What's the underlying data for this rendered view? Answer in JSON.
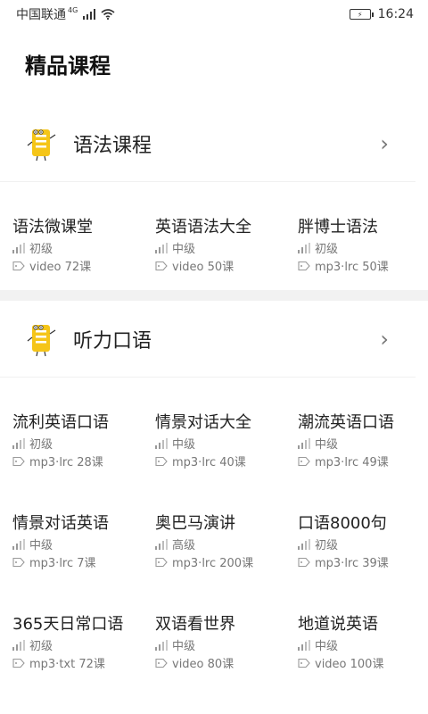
{
  "status_bar": {
    "carrier": "中国联通",
    "network": "4G",
    "time": "16:24"
  },
  "page_title": "精品课程",
  "sections": [
    {
      "title": "语法课程",
      "courses": [
        {
          "name": "语法微课堂",
          "level": "初级",
          "info": "video 72课"
        },
        {
          "name": "英语语法大全",
          "level": "中级",
          "info": "video 50课"
        },
        {
          "name": "胖博士语法",
          "level": "初级",
          "info": "mp3·lrc 50课"
        }
      ]
    },
    {
      "title": "听力口语",
      "courses": [
        {
          "name": "流利英语口语",
          "level": "初级",
          "info": "mp3·lrc 28课"
        },
        {
          "name": "情景对话大全",
          "level": "中级",
          "info": "mp3·lrc 40课"
        },
        {
          "name": "潮流英语口语",
          "level": "中级",
          "info": "mp3·lrc 49课"
        },
        {
          "name": "情景对话英语",
          "level": "中级",
          "info": "mp3·lrc 7课"
        },
        {
          "name": "奥巴马演讲",
          "level": "高级",
          "info": "mp3·lrc 200课"
        },
        {
          "name": "口语8000句",
          "level": "初级",
          "info": "mp3·lrc 39课"
        },
        {
          "name": "365天日常口语",
          "level": "初级",
          "info": "mp3·txt 72课"
        },
        {
          "name": "双语看世界",
          "level": "中级",
          "info": "video 80课"
        },
        {
          "name": "地道说英语",
          "level": "中级",
          "info": "video 100课"
        }
      ]
    }
  ]
}
